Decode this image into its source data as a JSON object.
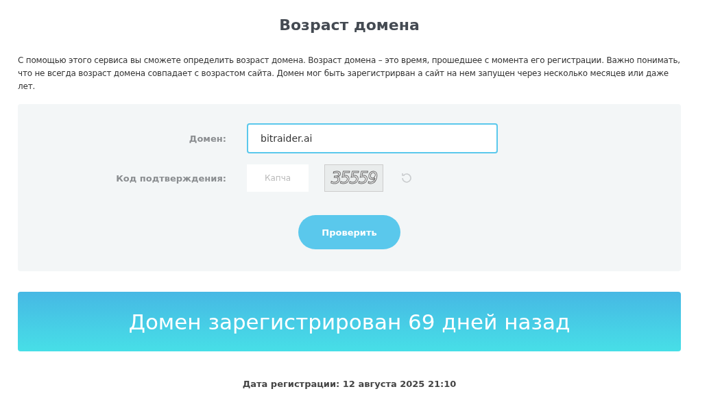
{
  "title": "Возраст домена",
  "description": "С помощью этого сервиса вы сможете определить возраст домена. Возраст домена – это время, прошедшее с момента его регистрации. Важно понимать, что не всегда возраст домена совпадает с возрастом сайта. Домен мог быть зарегистрирван а сайт на нем запущен через несколько месяцев или даже лет.",
  "form": {
    "domain": {
      "label": "Домен:",
      "value": "bitraider.ai",
      "focused": true
    },
    "captcha": {
      "label": "Код подтверждения:",
      "placeholder": "Капча",
      "code": "35559"
    },
    "submit": "Проверить"
  },
  "result": "Домен зарегистрирован 69 дней назад",
  "registration_date": "Дата регистрации: 12 августа 2025 21:10"
}
